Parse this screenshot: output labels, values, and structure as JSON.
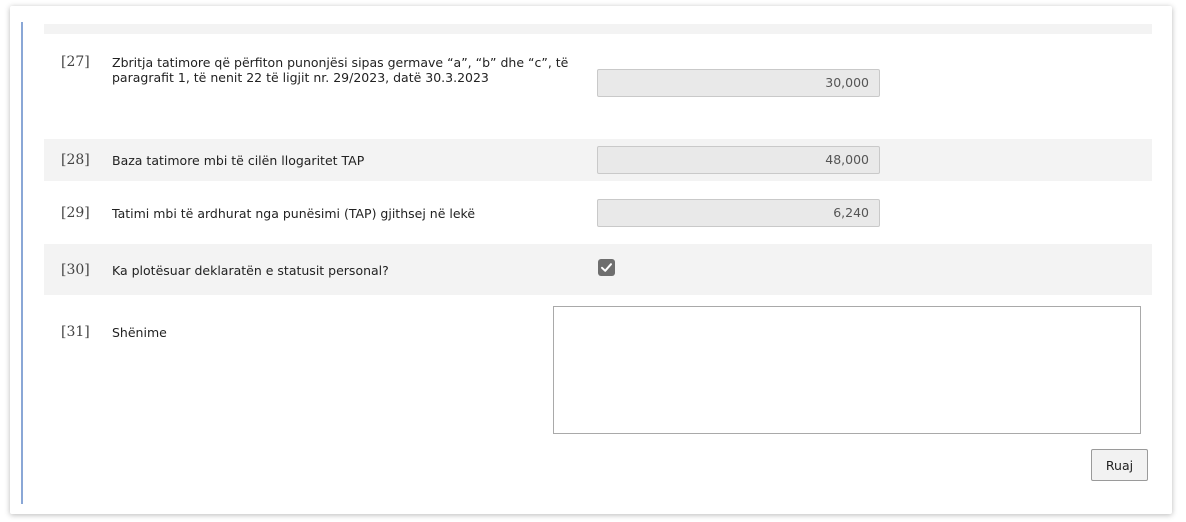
{
  "form": {
    "rows": [
      {
        "number": "[27]",
        "label": "Zbritja tatimore që përfiton punonjësi sipas germave “a”, “b” dhe “c”, të paragrafit 1, të nenit 22 të ligjit nr. 29/2023, datë 30.3.2023",
        "value": "30,000"
      },
      {
        "number": "[28]",
        "label": "Baza tatimore mbi të cilën llogaritet TAP",
        "value": "48,000"
      },
      {
        "number": "[29]",
        "label": "Tatimi mbi të ardhurat nga punësimi (TAP) gjithsej në lekë",
        "value": "6,240"
      },
      {
        "number": "[30]",
        "label": "Ka plotësuar deklaratën e statusit personal?",
        "checked": true
      },
      {
        "number": "[31]",
        "label": "Shënime",
        "value": ""
      }
    ],
    "save_label": "Ruaj"
  },
  "icons": {
    "checkbox": "checkmark-icon",
    "resize": "resize-grip-icon"
  },
  "colors": {
    "row_shade": "#f3f3f3",
    "field_bg": "#e9e9e9",
    "accent_bar": "#8aa7d6",
    "checkbox": "#6e6e6e"
  }
}
